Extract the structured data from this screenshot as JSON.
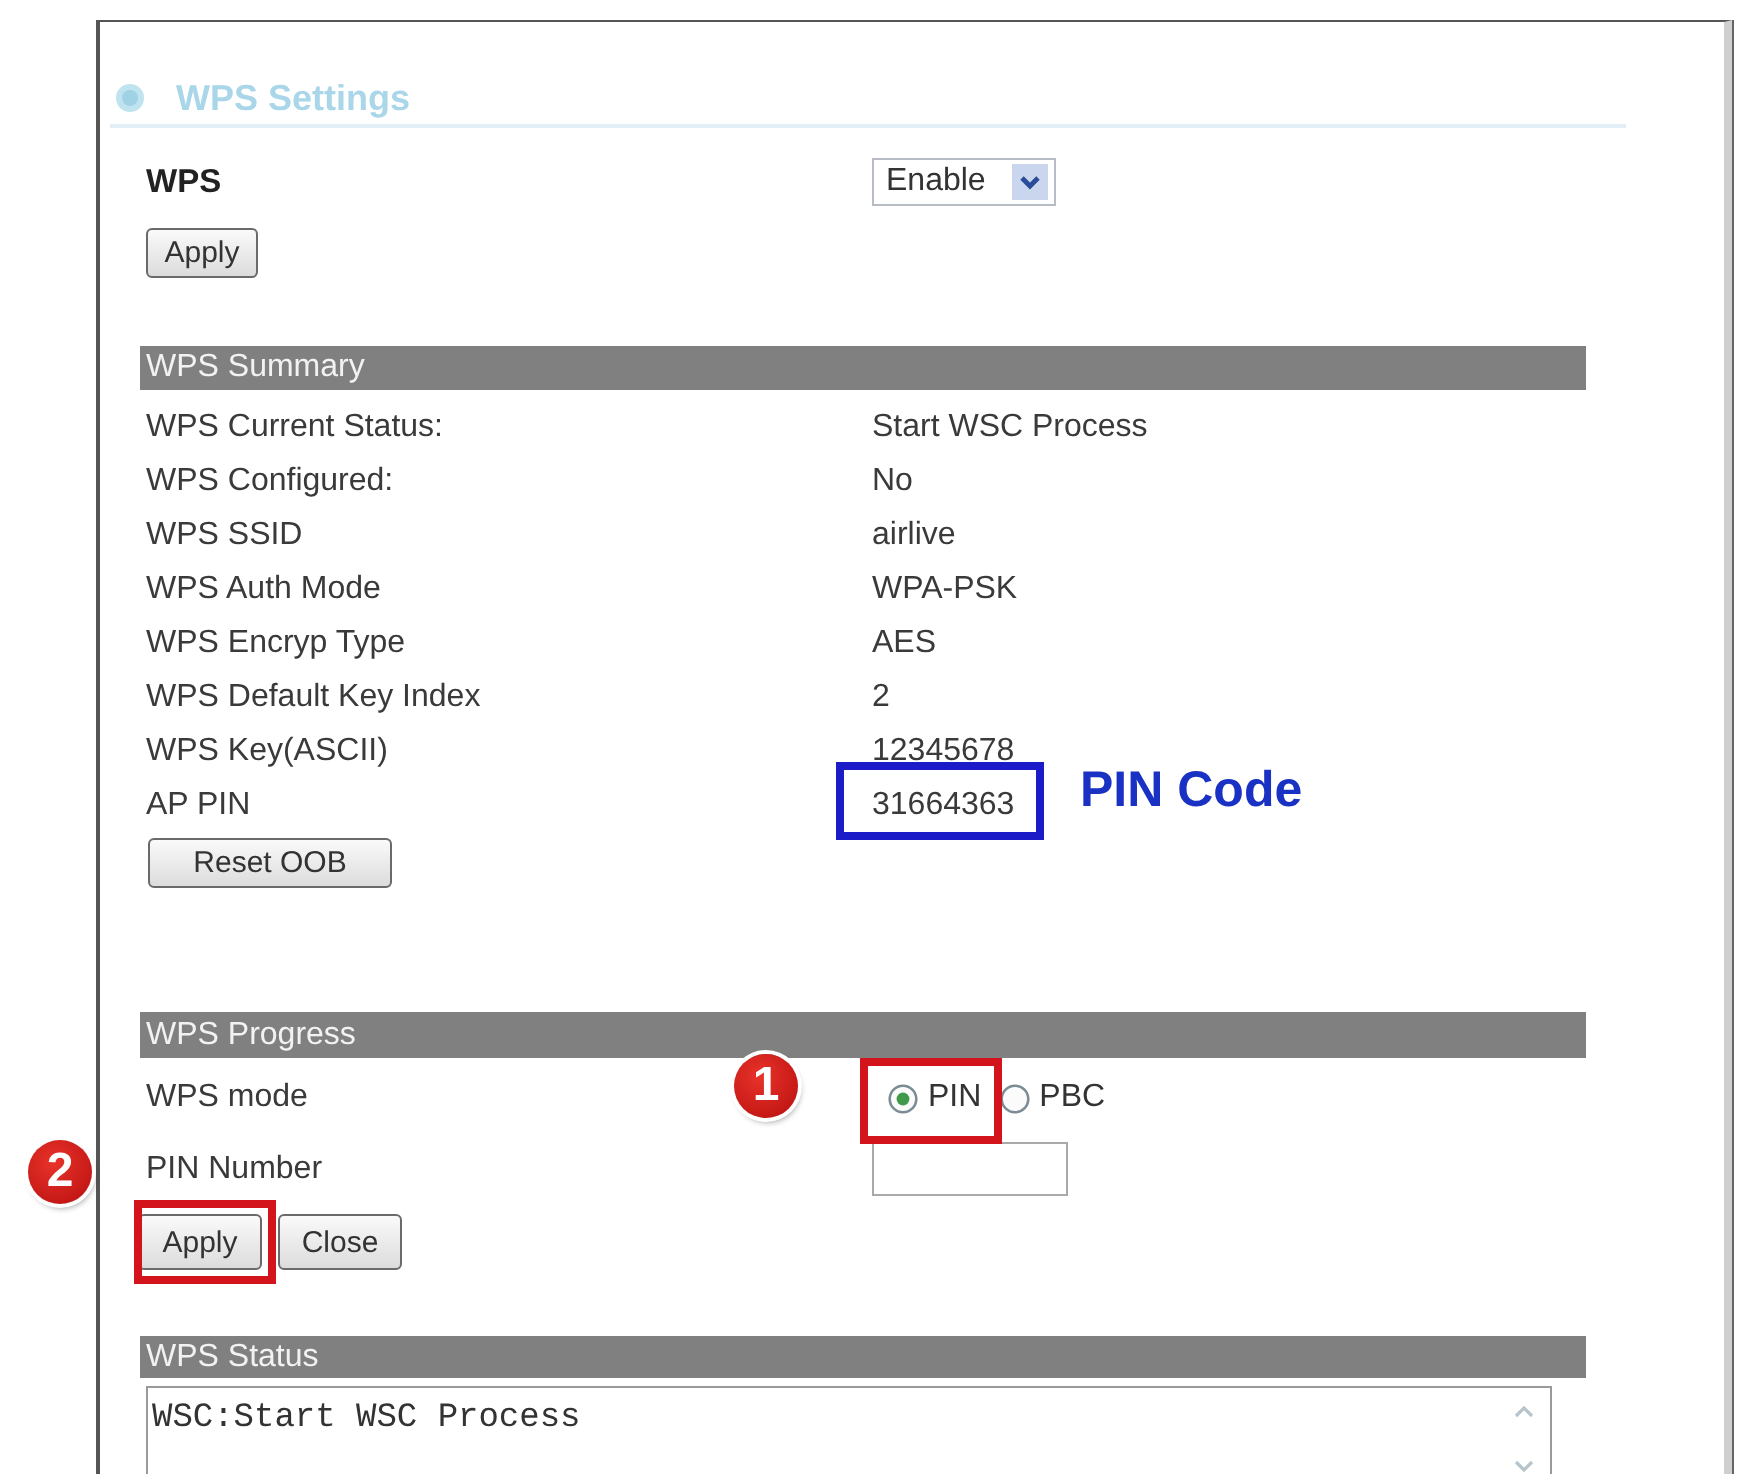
{
  "page": {
    "title": "WPS Settings"
  },
  "wps": {
    "label": "WPS",
    "select_value": "Enable",
    "apply_button": "Apply"
  },
  "summary": {
    "heading": "WPS Summary",
    "rows": [
      {
        "label": "WPS Current Status:",
        "value": "Start WSC Process"
      },
      {
        "label": "WPS Configured:",
        "value": "No"
      },
      {
        "label": "WPS SSID",
        "value": "airlive"
      },
      {
        "label": "WPS Auth Mode",
        "value": "WPA-PSK"
      },
      {
        "label": "WPS Encryp Type",
        "value": "AES"
      },
      {
        "label": "WPS Default Key Index",
        "value": "2"
      },
      {
        "label": "WPS Key(ASCII)",
        "value": "12345678"
      },
      {
        "label": "AP PIN",
        "value": "31664363"
      }
    ],
    "reset_button": "Reset OOB"
  },
  "progress": {
    "heading": "WPS Progress",
    "mode_label": "WPS mode",
    "modes": [
      {
        "label": "PIN",
        "selected": true
      },
      {
        "label": "PBC",
        "selected": false
      }
    ],
    "pin_label": "PIN Number",
    "buttons": [
      "Apply",
      "Close"
    ]
  },
  "status": {
    "heading": "WPS Status",
    "log": "WSC:Start WSC Process"
  },
  "annotations": {
    "pin_code_label": "PIN Code",
    "steps": [
      {
        "number": "1"
      },
      {
        "number": "2"
      }
    ]
  }
}
